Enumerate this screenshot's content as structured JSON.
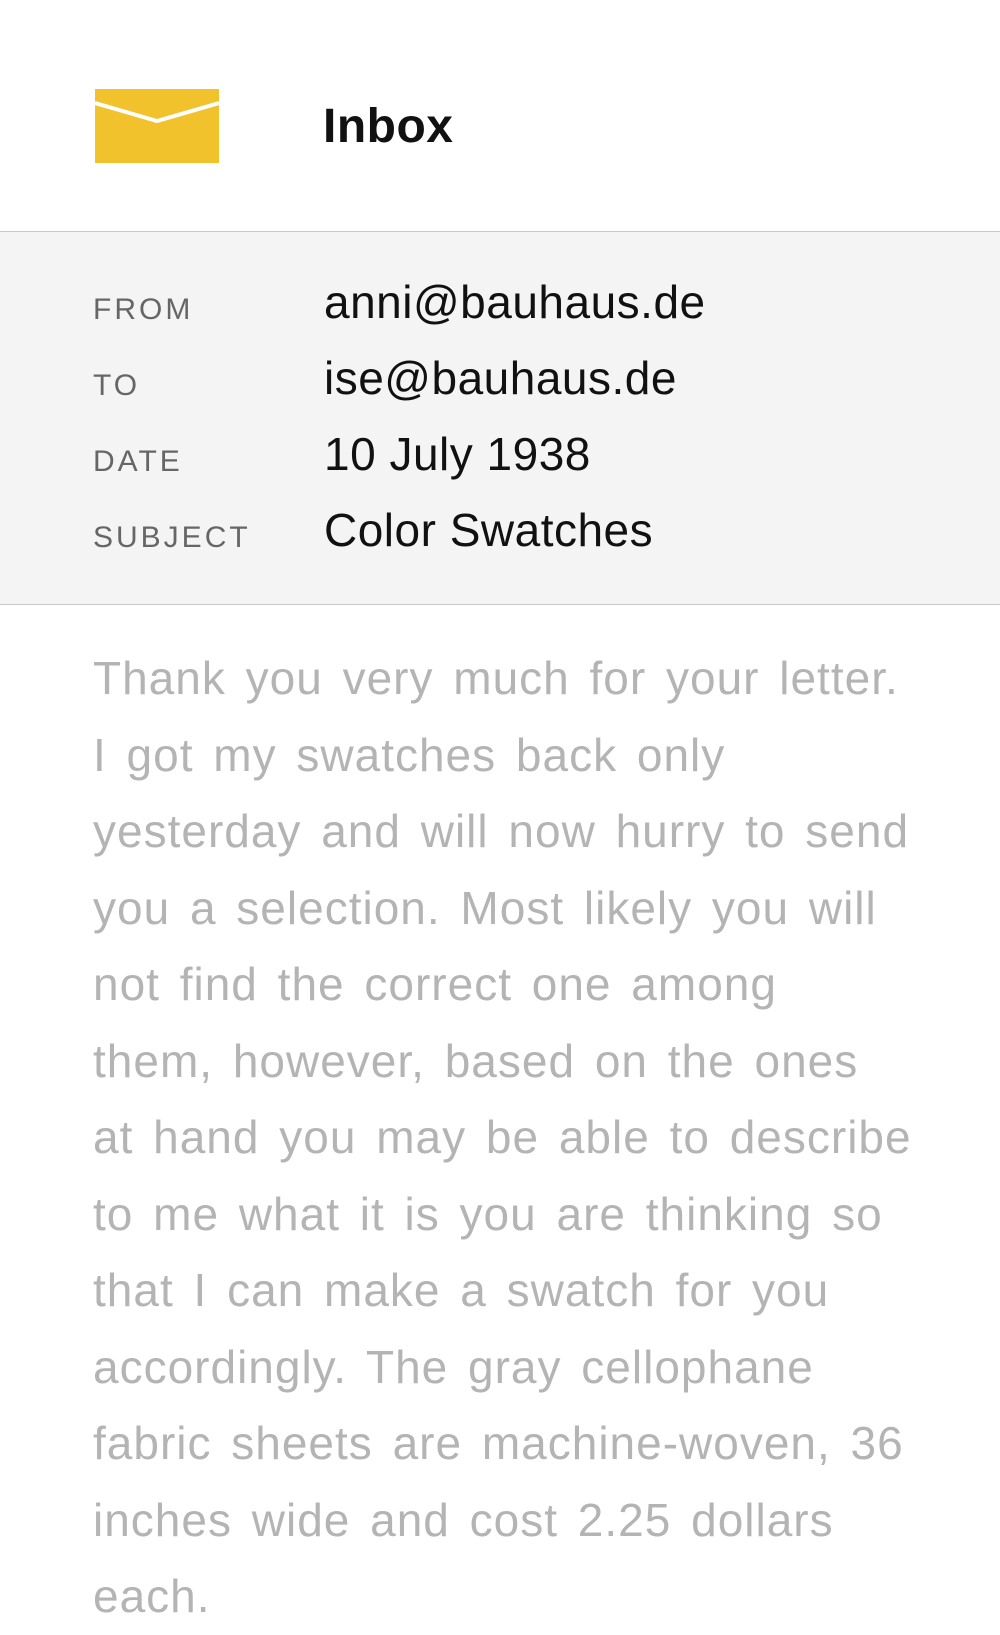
{
  "app": {
    "title": "Inbox",
    "icon": "envelope-icon",
    "accent_color": "#f2c22c"
  },
  "message": {
    "fields": [
      {
        "label": "FROM",
        "value": "anni@bauhaus.de"
      },
      {
        "label": "TO",
        "value": "ise@bauhaus.de"
      },
      {
        "label": "DATE",
        "value": "10 July 1938"
      },
      {
        "label": "SUBJECT",
        "value": "Color Swatches"
      }
    ],
    "body": "Thank you very much for your letter. I got my swatches back only yesterday and will now hurry to send you a selection. Most likely you will not find the correct one among them, however, based on the ones at hand you may be able to describe to me what it is you are thinking so that I can make a swatch for you accordingly. The gray cellophane fabric sheets are machine-woven, 36 inches wide and cost 2.25 dollars each."
  }
}
